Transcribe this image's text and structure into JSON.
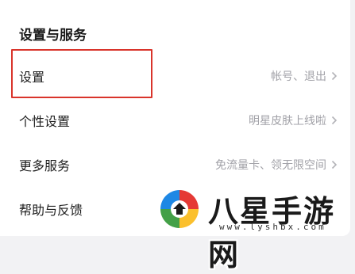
{
  "section": {
    "title": "设置与服务"
  },
  "rows": [
    {
      "label": "设置",
      "value": "帐号、退出"
    },
    {
      "label": "个性设置",
      "value": "明星皮肤上线啦"
    },
    {
      "label": "更多服务",
      "value": "免流量卡、领无限空间"
    },
    {
      "label": "帮助与反馈",
      "value": ""
    }
  ],
  "watermark": {
    "brand": "八星手游网",
    "domain": "www.lyshbx.com"
  },
  "colors": {
    "highlight": "#d9342b",
    "value_text": "#a2a2a8"
  }
}
